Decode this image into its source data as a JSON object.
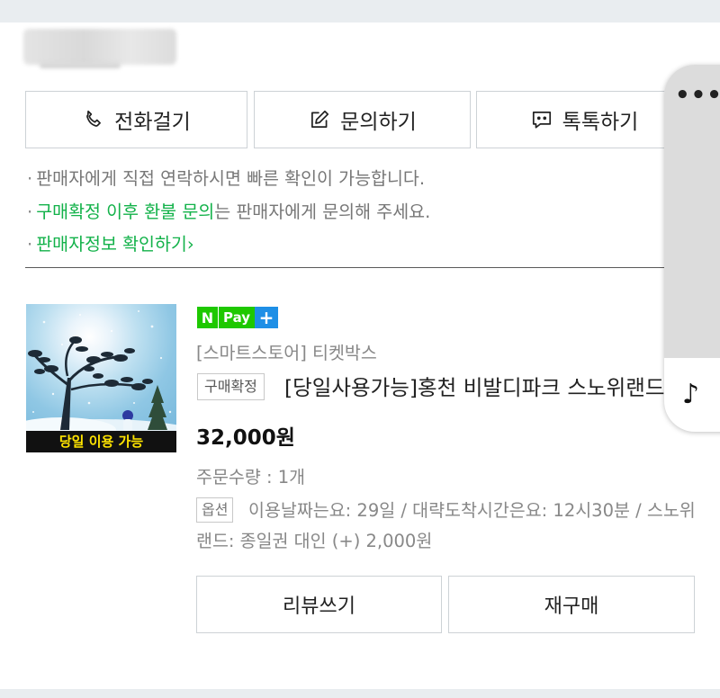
{
  "seller": {
    "name": ""
  },
  "actions": {
    "call": "전화걸기",
    "inquiry": "문의하기",
    "talktalk": "톡톡하기"
  },
  "notices": {
    "line1": "판매자에게 직접 연락하시면 빠른 확인이 가능합니다.",
    "line2_highlight": "구매확정 이후 환불 문의",
    "line2_rest": "는 판매자에게 문의해 주세요.",
    "line3": "판매자정보 확인하기",
    "line3_arrow": "›"
  },
  "product": {
    "thumbnail_caption": "당일 이용 가능",
    "pay_badge": {
      "n": "N",
      "text": "Pay",
      "plus": "+"
    },
    "store": "[스마트스토어] 티켓박스",
    "status_badge": "구매확정",
    "title": "[당일사용가능]홍천 비발디파크 스노위랜드",
    "price": "32,000원",
    "quantity": "주문수량 : 1개",
    "option_badge": "옵션",
    "option_text": "이용날짜는요: 29일 / 대략도착시간은요: 12시30분 / 스노위랜드: 종일권 대인 (+) 2,000원"
  },
  "buttons": {
    "review": "리뷰쓰기",
    "rebuy": "재구매"
  },
  "floating": {
    "more_icon": "•••",
    "music_icon": "♪"
  },
  "colors": {
    "accent_green": "#13b24a",
    "npay_green": "#1ec800",
    "npay_blue": "#1e8fe6"
  }
}
